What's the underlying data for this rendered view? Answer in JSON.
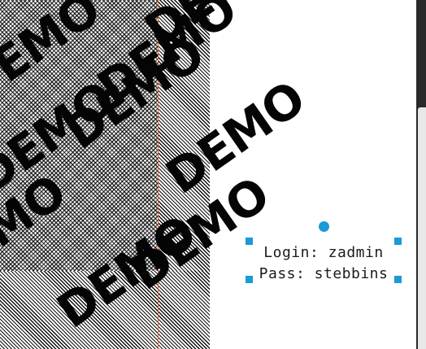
{
  "canvas": {
    "watermarks": [
      "DEMO",
      "DEMO",
      "DEMO",
      "DEMO",
      "DEMO",
      "DEMO",
      "DEMO",
      "DEMO",
      "DEMO"
    ],
    "text_box": {
      "line1": "Login: zadmin",
      "line2": "Pass: stebbins"
    }
  },
  "colors": {
    "selection_handle": "#1a9ad6",
    "guide_line": "#e2652f",
    "scrollbar_track": "#2a2a2a",
    "scrollbar_thumb": "#e8e8e8"
  },
  "icons": {
    "rotate_handle": "circle",
    "resize_handle": "square"
  }
}
